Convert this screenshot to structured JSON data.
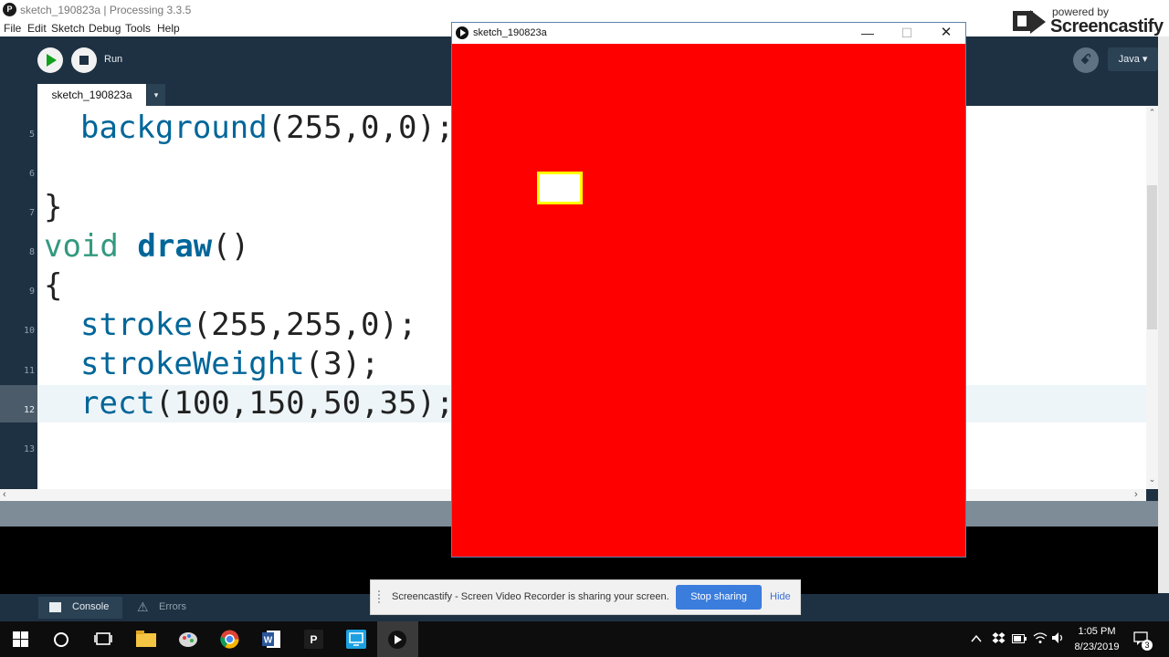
{
  "window": {
    "title": "sketch_190823a | Processing 3.3.5",
    "app_icon_glyph": "P"
  },
  "menu": [
    "File",
    "Edit",
    "Sketch",
    "Debug",
    "Tools",
    "Help"
  ],
  "toolbar": {
    "run_label": "Run",
    "mode": "Java ▾",
    "debug_icon": "debug-icon"
  },
  "tabs": {
    "active": "sketch_190823a",
    "menu_arrow": "▾"
  },
  "editor": {
    "line_numbers": [
      "5",
      "6",
      "7",
      "8",
      "9",
      "10",
      "11",
      "12",
      "13"
    ],
    "code": {
      "l5_fn": "background",
      "l5_args": "(255,0,0);",
      "l7": "}",
      "l8_kw": "void",
      "l8_fn": "draw",
      "l8_rest": "()",
      "l9": "{",
      "l10_fn": "stroke",
      "l10_args": "(255,255,0);",
      "l11_fn": "strokeWeight",
      "l11_args": "(3);",
      "l12_fn": "rect",
      "l12_args": "(100,150,50,35);"
    },
    "highlight_line": "12"
  },
  "console": {
    "console_label": "Console",
    "errors_label": "Errors"
  },
  "sketch_window": {
    "title": "sketch_190823a",
    "background_color": "#ff0000",
    "rect_fill": "#ffffff",
    "rect_stroke": "#ffff00",
    "buttons": {
      "minimize": "—",
      "maximize": "☐",
      "close": "✕"
    }
  },
  "watermark": {
    "small": "powered by",
    "big": "Screencastify"
  },
  "notification": {
    "text": "Screencastify - Screen Video Recorder is sharing your screen.",
    "stop_label": "Stop sharing",
    "hide_label": "Hide"
  },
  "taskbar": {
    "time": "1:05 PM",
    "date": "8/23/2019",
    "notification_count": "3",
    "apps": [
      "windows-start-icon",
      "cortana-icon",
      "task-view-icon",
      "file-explorer-icon",
      "paint-icon",
      "chrome-icon",
      "word-icon",
      "processing-icon",
      "remote-desktop-icon",
      "sketch-app-icon"
    ]
  }
}
